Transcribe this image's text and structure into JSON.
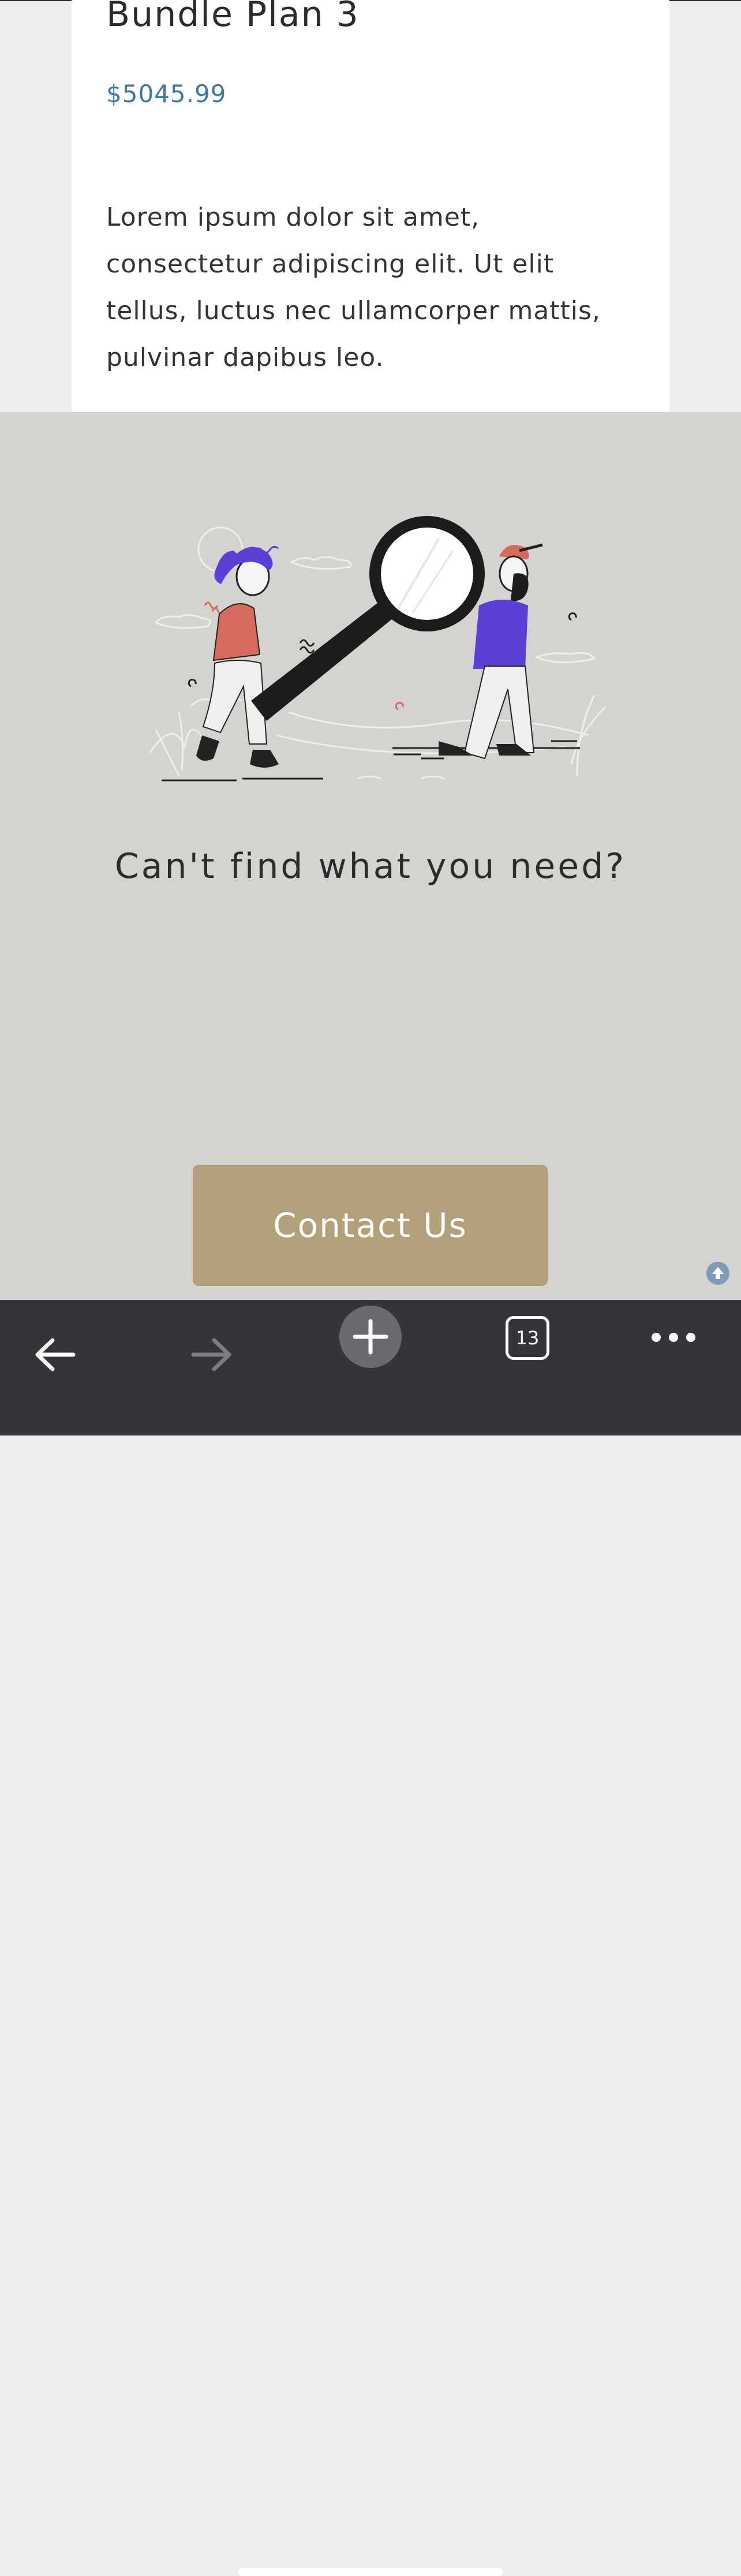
{
  "card": {
    "title": "Bundle Plan 3",
    "price": "$5045.99",
    "description": "Lorem ipsum dolor sit amet, consectetur adipiscing elit. Ut elit tellus, luctus nec ullamcorper mattis, pulvinar dapibus leo."
  },
  "cta": {
    "headline": "Can't find what you need?",
    "button_label": "Contact Us"
  },
  "toolbar": {
    "tab_count": "13",
    "items": [
      "back-arrow-icon",
      "forward-arrow-icon",
      "new-tab-plus-icon",
      "tabs-icon",
      "more-icon"
    ]
  },
  "colors": {
    "price": "#3d7a9e",
    "cta_background": "#d5d3cf",
    "button": "#b1a07a",
    "toolbar": "#343539"
  }
}
